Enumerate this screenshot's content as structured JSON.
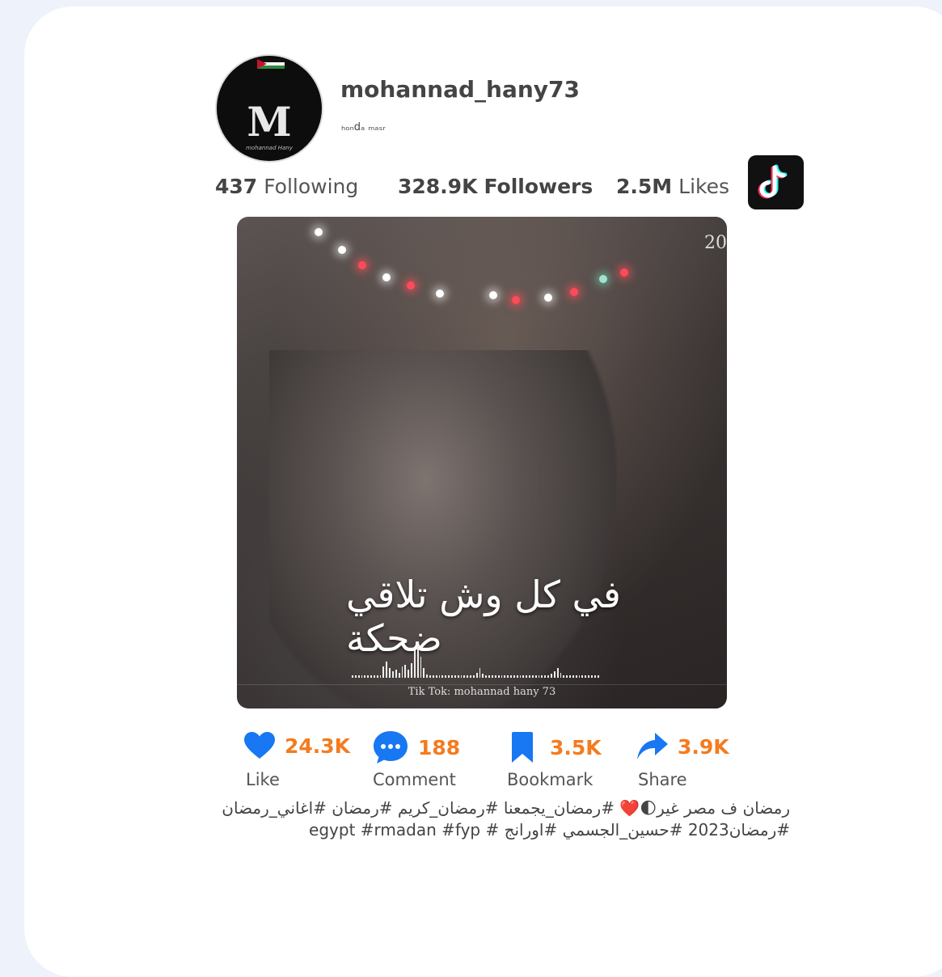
{
  "profile": {
    "username": "mohannad_hany73",
    "bio": "ₕₒₙdₐ ₘₐₛᵣ",
    "avatar_letter": "M",
    "avatar_signature": "mohannad Hany"
  },
  "stats": {
    "following_count": "437",
    "following_label": "Following",
    "followers_count": "328.9K",
    "followers_label": "Followers",
    "likes_count": "2.5M",
    "likes_label": "Likes"
  },
  "video": {
    "year_overlay": "20",
    "arabic_overlay": "في كل وش تلاقي ضحكة",
    "watermark": "Tik Tok: mohannad hany 73"
  },
  "actions": {
    "like_count": "24.3K",
    "like_label": "Like",
    "comment_count": "188",
    "comment_label": "Comment",
    "bookmark_count": "3.5K",
    "bookmark_label": "Bookmark",
    "share_count": "3.9K",
    "share_label": "Share"
  },
  "caption": "رمضان ف مصر غير🌓❤️ #رمضان_يجمعنا #رمضان_كريم #رمضان #اغاني_رمضان #رمضان2023 #حسين_الجسمي #اورانج # egypt #rmadan #fyp",
  "colors": {
    "accent_count": "#f47b20",
    "icon_blue": "#1877f2",
    "page_bg": "#eef2fb",
    "card_bg": "#ffffff"
  },
  "icons": [
    "tiktok-logo-icon",
    "heart-icon",
    "comment-bubble-icon",
    "bookmark-icon",
    "share-arrow-icon"
  ]
}
